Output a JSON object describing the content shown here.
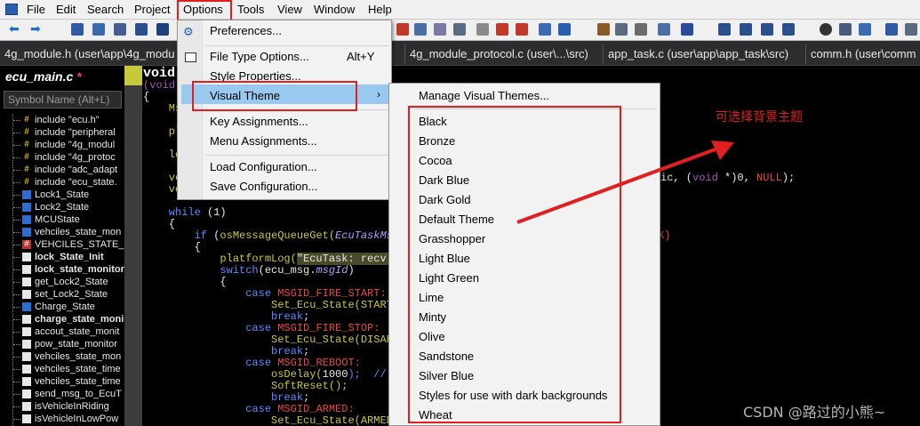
{
  "menubar": {
    "items": [
      "File",
      "Edit",
      "Search",
      "Project",
      "Options",
      "Tools",
      "View",
      "Window",
      "Help"
    ]
  },
  "tabs": [
    "4g_module.h (user\\app\\4g_modu",
    "4g_module_protocol.c (user\\...\\src)",
    "app_task.c (user\\app\\app_task\\src)",
    "comm.h (user\\comm"
  ],
  "symbol_window": {
    "title": "ecu_main.c",
    "modified_mark": "*",
    "search_placeholder": "Symbol Name (Alt+L)",
    "items": [
      {
        "label": "include \"ecu.h\"",
        "icon": "include-icon",
        "bold": false
      },
      {
        "label": "include \"peripheral",
        "icon": "include-icon",
        "bold": false
      },
      {
        "label": "include \"4g_modul",
        "icon": "include-icon",
        "bold": false
      },
      {
        "label": "include \"4g_protoc",
        "icon": "include-icon",
        "bold": false
      },
      {
        "label": "include \"adc_adapt",
        "icon": "include-icon",
        "bold": false
      },
      {
        "label": "include \"ecu_state.",
        "icon": "include-icon",
        "bold": false
      },
      {
        "label": "Lock1_State",
        "icon": "variable-icon",
        "bold": false
      },
      {
        "label": "Lock2_State",
        "icon": "variable-icon",
        "bold": false
      },
      {
        "label": "MCUState",
        "icon": "variable-icon",
        "bold": false
      },
      {
        "label": "vehciles_state_mon",
        "icon": "variable-icon",
        "bold": false
      },
      {
        "label": "VEHCILES_STATE_TI",
        "icon": "macro-icon",
        "bold": false
      },
      {
        "label": "lock_State_Init",
        "icon": "function-icon",
        "bold": true
      },
      {
        "label": "lock_state_monitor",
        "icon": "function-icon",
        "bold": true
      },
      {
        "label": "get_Lock2_State",
        "icon": "function-icon",
        "bold": false
      },
      {
        "label": "set_Lock2_State",
        "icon": "function-icon",
        "bold": false
      },
      {
        "label": "Charge_State",
        "icon": "variable-icon",
        "bold": false
      },
      {
        "label": "charge_state_moni",
        "icon": "function-icon",
        "bold": true
      },
      {
        "label": "accout_state_monit",
        "icon": "function-icon",
        "bold": false
      },
      {
        "label": "pow_state_monitor",
        "icon": "function-icon",
        "bold": false
      },
      {
        "label": "vehciles_state_mon",
        "icon": "function-icon",
        "bold": false
      },
      {
        "label": "vehciles_state_time",
        "icon": "function-icon",
        "bold": false
      },
      {
        "label": "vehciles_state_time",
        "icon": "function-icon",
        "bold": false
      },
      {
        "label": "send_msg_to_EcuT",
        "icon": "function-icon",
        "bold": false
      },
      {
        "label": "isVehicleInRiding",
        "icon": "function-icon",
        "bold": false
      },
      {
        "label": "isVehicleInLowPow",
        "icon": "function-icon",
        "bold": false
      }
    ]
  },
  "code_lines": [
    {
      "parts": [
        {
          "t": "void",
          "c": "#ffffff",
          "b": true
        }
      ]
    },
    {
      "parts": [
        {
          "t": "(void",
          "c": "#9b59b6"
        }
      ]
    },
    {
      "parts": [
        {
          "t": "{",
          "c": "#e6e6e6"
        }
      ]
    },
    {
      "parts": [
        {
          "t": "    Ms",
          "c": "#c8c83c"
        }
      ]
    },
    {
      "parts": []
    },
    {
      "parts": [
        {
          "t": "    pl",
          "c": "#c8c83c"
        }
      ]
    },
    {
      "parts": []
    },
    {
      "parts": [
        {
          "t": "    lo",
          "c": "#c8c83c"
        }
      ]
    },
    {
      "parts": []
    },
    {
      "parts": [
        {
          "t": "    ve",
          "c": "#c8c83c"
        }
      ]
    },
    {
      "parts": [
        {
          "t": "    ve",
          "c": "#c8c83c"
        }
      ]
    },
    {
      "parts": []
    },
    {
      "parts": [
        {
          "t": "    while",
          "c": "#5b8cff"
        },
        {
          "t": " (",
          "c": "#e6e6e6"
        },
        {
          "t": "1",
          "c": "#e6e6e6"
        },
        {
          "t": ")",
          "c": "#e6e6e6"
        }
      ]
    },
    {
      "parts": [
        {
          "t": "    {",
          "c": "#e6e6e6"
        }
      ]
    },
    {
      "parts": [
        {
          "t": "        if",
          "c": "#5b8cff"
        },
        {
          "t": " (",
          "c": "#e6e6e6"
        },
        {
          "t": "osMessageQueueGet(",
          "c": "#c8c83c"
        },
        {
          "t": "EcuTaskMsg",
          "c": "#b59cff",
          "i": true
        }
      ]
    },
    {
      "parts": [
        {
          "t": "        {",
          "c": "#e6e6e6"
        }
      ]
    },
    {
      "parts": [
        {
          "t": "            platformLog(",
          "c": "#c8c83c"
        },
        {
          "t": "\"EcuTask: recv m",
          "c": "#e6e6e6",
          "bg": "#4a4a2a"
        }
      ]
    },
    {
      "parts": [
        {
          "t": "            switch",
          "c": "#5b8cff"
        },
        {
          "t": "(ecu_msg.",
          "c": "#e6e6e6"
        },
        {
          "t": "msgId",
          "c": "#b59cff",
          "i": true
        },
        {
          "t": ")",
          "c": "#e6e6e6"
        }
      ]
    },
    {
      "parts": [
        {
          "t": "            {",
          "c": "#e6e6e6"
        }
      ]
    },
    {
      "parts": [
        {
          "t": "                case",
          "c": "#5b8cff"
        },
        {
          "t": " MSGID_FIRE_START:",
          "c": "#e8464b"
        }
      ]
    },
    {
      "parts": [
        {
          "t": "                    Set_Ecu_State(STARTE",
          "c": "#c8c83c"
        }
      ]
    },
    {
      "parts": [
        {
          "t": "                    break",
          "c": "#5b8cff"
        },
        {
          "t": ";",
          "c": "#e6e6e6"
        }
      ]
    },
    {
      "parts": [
        {
          "t": "                case",
          "c": "#5b8cff"
        },
        {
          "t": " MSGID_FIRE_STOP:",
          "c": "#e8464b"
        }
      ]
    },
    {
      "parts": [
        {
          "t": "                    Set_Ecu_State(DISARM",
          "c": "#c8c83c"
        }
      ]
    },
    {
      "parts": [
        {
          "t": "                    break",
          "c": "#5b8cff"
        },
        {
          "t": ";",
          "c": "#e6e6e6"
        }
      ]
    },
    {
      "parts": [
        {
          "t": "                case",
          "c": "#5b8cff"
        },
        {
          "t": " MSGID_REBOOT:",
          "c": "#e8464b"
        }
      ]
    },
    {
      "parts": [
        {
          "t": "                    osDelay(",
          "c": "#c8c83c"
        },
        {
          "t": "1000",
          "c": "#e6e6e6"
        },
        {
          "t": ");  // ",
          "c": "#5b8cff"
        }
      ]
    },
    {
      "parts": [
        {
          "t": "                    SoftReset();",
          "c": "#c8c83c"
        }
      ]
    },
    {
      "parts": [
        {
          "t": "                    break",
          "c": "#5b8cff"
        },
        {
          "t": ";",
          "c": "#e6e6e6"
        }
      ]
    },
    {
      "parts": [
        {
          "t": "                case",
          "c": "#5b8cff"
        },
        {
          "t": " MSGID_ARMED:",
          "c": "#e8464b"
        }
      ]
    },
    {
      "parts": [
        {
          "t": "                    Set_Ecu_State(ARMED",
          "c": "#c8c83c"
        }
      ]
    }
  ],
  "code_right": [
    {
      "parts": [
        {
          "t": "ic, (",
          "c": "#e6e6e6"
        },
        {
          "t": "void",
          "c": "#9b59b6"
        },
        {
          "t": " *)0, ",
          "c": "#e6e6e6"
        },
        {
          "t": "NULL",
          "c": "#e8464b"
        },
        {
          "t": ");",
          "c": "#e6e6e6"
        }
      ]
    },
    {
      "parts": [
        {
          "t": "K)",
          "c": "#e8464b"
        }
      ]
    }
  ],
  "options_menu": {
    "items": [
      {
        "label": "Preferences...",
        "shortcut": "",
        "icon": "gear-icon"
      },
      {
        "label": "File Type Options...",
        "shortcut": "Alt+Y",
        "icon": "file-type-icon"
      },
      {
        "label": "Style Properties...",
        "shortcut": "",
        "icon": ""
      },
      {
        "label": "Visual Theme",
        "shortcut": "",
        "icon": "",
        "submenu": true
      },
      {
        "label": "Key Assignments...",
        "shortcut": "",
        "icon": ""
      },
      {
        "label": "Menu Assignments...",
        "shortcut": "",
        "icon": ""
      },
      {
        "label": "Load Configuration...",
        "shortcut": "",
        "icon": ""
      },
      {
        "label": "Save Configuration...",
        "shortcut": "",
        "icon": ""
      }
    ]
  },
  "theme_submenu": {
    "manage": "Manage Visual Themes...",
    "themes": [
      "Black",
      "Bronze",
      "Cocoa",
      "Dark Blue",
      "Dark Gold",
      "Default Theme",
      "Grasshopper",
      "Light Blue",
      "Light Green",
      "Lime",
      "Minty",
      "Olive",
      "Sandstone",
      "Silver Blue",
      "Styles for use with dark backgrounds",
      "Wheat"
    ]
  },
  "annotation": "可选择背景主题",
  "watermark": "CSDN @路过的小熊~",
  "colors": {
    "highlight_red": "#e02020",
    "menu_hover": "#99c9ef"
  }
}
